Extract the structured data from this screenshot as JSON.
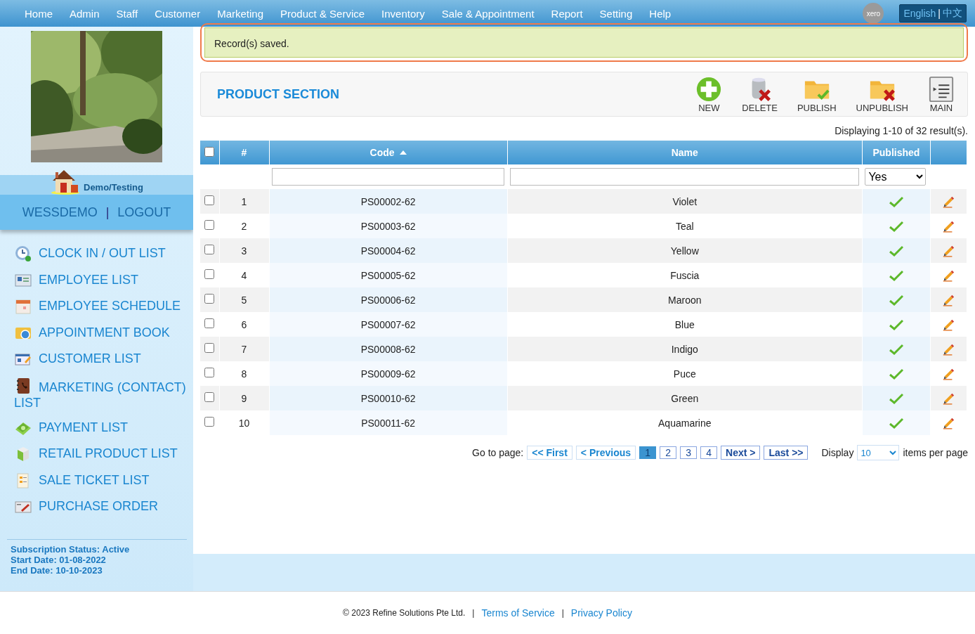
{
  "nav": [
    {
      "label": "Home"
    },
    {
      "label": "Admin"
    },
    {
      "label": "Staff"
    },
    {
      "label": "Customer"
    },
    {
      "label": "Marketing"
    },
    {
      "label": "Product & Service"
    },
    {
      "label": "Inventory"
    },
    {
      "label": "Sale & Appointment"
    },
    {
      "label": "Report"
    },
    {
      "label": "Setting"
    },
    {
      "label": "Help"
    }
  ],
  "xero": "xero",
  "language": {
    "english": "English",
    "separator": "|",
    "chinese": "中文"
  },
  "account": {
    "badge": "Demo/Testing",
    "username": "WESSDEMO",
    "separator": "|",
    "logout": "LOGOUT"
  },
  "menu": [
    {
      "label": "CLOCK IN / OUT LIST"
    },
    {
      "label": "EMPLOYEE LIST"
    },
    {
      "label": "EMPLOYEE SCHEDULE"
    },
    {
      "label": "APPOINTMENT BOOK"
    },
    {
      "label": "CUSTOMER LIST"
    },
    {
      "label": "MARKETING (CONTACT) LIST"
    },
    {
      "label": "PAYMENT LIST"
    },
    {
      "label": "RETAIL PRODUCT LIST"
    },
    {
      "label": "SALE TICKET LIST"
    },
    {
      "label": "PURCHASE ORDER"
    }
  ],
  "subscription": [
    "Subscription Status: Active",
    "Start Date: 01-08-2022",
    "End Date: 10-10-2023"
  ],
  "message": "Record(s) saved.",
  "section_title": "PRODUCT SECTION",
  "toolbar": [
    {
      "label": "NEW"
    },
    {
      "label": "DELETE"
    },
    {
      "label": "PUBLISH"
    },
    {
      "label": "UNPUBLISH"
    },
    {
      "label": "MAIN"
    }
  ],
  "results": "Displaying 1-10 of 32 result(s).",
  "table": {
    "select_all": false,
    "columns": [
      {
        "label": "#"
      },
      {
        "label": "Code",
        "sorted": true
      },
      {
        "label": "Name"
      },
      {
        "label": "Published"
      }
    ],
    "filter": {
      "published": "Yes"
    },
    "rows": [
      {
        "checked": false,
        "num": "1",
        "code": "PS00002-62",
        "name": "Violet",
        "published": true
      },
      {
        "checked": false,
        "num": "2",
        "code": "PS00003-62",
        "name": "Teal",
        "published": true
      },
      {
        "checked": false,
        "num": "3",
        "code": "PS00004-62",
        "name": "Yellow",
        "published": true
      },
      {
        "checked": false,
        "num": "4",
        "code": "PS00005-62",
        "name": "Fuscia",
        "published": true
      },
      {
        "checked": false,
        "num": "5",
        "code": "PS00006-62",
        "name": "Maroon",
        "published": true
      },
      {
        "checked": false,
        "num": "6",
        "code": "PS00007-62",
        "name": "Blue",
        "published": true
      },
      {
        "checked": false,
        "num": "7",
        "code": "PS00008-62",
        "name": "Indigo",
        "published": true
      },
      {
        "checked": false,
        "num": "8",
        "code": "PS00009-62",
        "name": "Puce",
        "published": true
      },
      {
        "checked": false,
        "num": "9",
        "code": "PS00010-62",
        "name": "Green",
        "published": true
      },
      {
        "checked": false,
        "num": "10",
        "code": "PS00011-62",
        "name": "Aquamarine",
        "published": true
      }
    ]
  },
  "pagination": {
    "goto": "Go to page:",
    "first": "<< First",
    "previous": "< Previous",
    "pages": [
      {
        "label": "1",
        "selected": true
      },
      {
        "label": "2",
        "selected": false
      },
      {
        "label": "3",
        "selected": false
      },
      {
        "label": "4",
        "selected": false
      }
    ],
    "next": "Next >",
    "last": "Last >>",
    "display": "Display",
    "page_size": "10",
    "per_page": "items per page"
  },
  "footer": {
    "copyright": "© 2023 Refine Solutions Pte Ltd.",
    "separator_1": "|",
    "terms": "Terms of Service",
    "separator_2": "|",
    "privacy": "Privacy Policy"
  }
}
